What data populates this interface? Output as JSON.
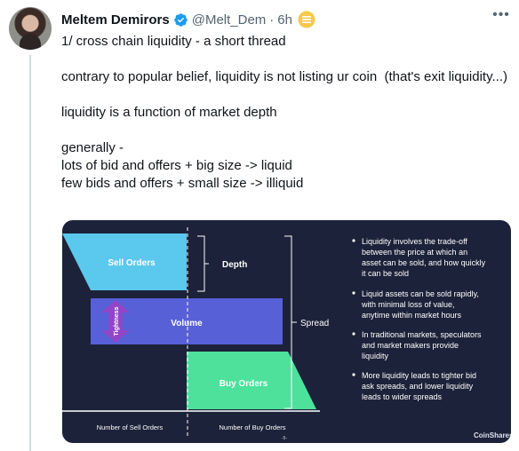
{
  "tweet": {
    "author_name": "Meltem Demirors",
    "handle": "@Melt_Dem",
    "separator": "·",
    "time": "6h",
    "more_icon": "•••",
    "lines": [
      "1/ cross chain liquidity - a short thread",
      "",
      "contrary to popular belief, liquidity is not listing ur coin  (that's exit liquidity...)",
      "",
      "liquidity is a function of market depth",
      "",
      "generally -",
      "lots of bid and offers + big size -> liquid",
      "few bids and offers + small size -> illiquid"
    ]
  },
  "infographic": {
    "sell_orders": "Sell Orders",
    "depth": "Depth",
    "volume": "Volume",
    "tightness": "Tightness",
    "spread": "Spread",
    "buy_orders": "Buy Orders",
    "axis_left": "Number of Sell Orders",
    "axis_right": "Number of Buy Orders",
    "page_marker": "-5-",
    "brand": "CoinShares",
    "bullets": [
      [
        "Liquidity involves the trade-off",
        "between the price at which an",
        "asset can be sold, and how quickly",
        "it can be sold"
      ],
      [
        "Liquid assets can be sold rapidly,",
        "with minimal loss of value,",
        "anytime within market hours"
      ],
      [
        "In traditional markets, speculators",
        "and market makers provide",
        "liquidity"
      ],
      [
        "More liquidity leads to tighter bid",
        "ask spreads, and lower liquidity",
        "leads to wider spreads"
      ]
    ],
    "colors": {
      "background": "#1c2239",
      "sell": "#5bc8ee",
      "volume": "#5760d6",
      "buy": "#4ee19c",
      "arrow": "#9146c7",
      "text": "#ffffff"
    }
  },
  "icons": {
    "verified": "verified-badge-icon",
    "emoji": "bank-emoji-icon",
    "more": "more-options-icon"
  }
}
